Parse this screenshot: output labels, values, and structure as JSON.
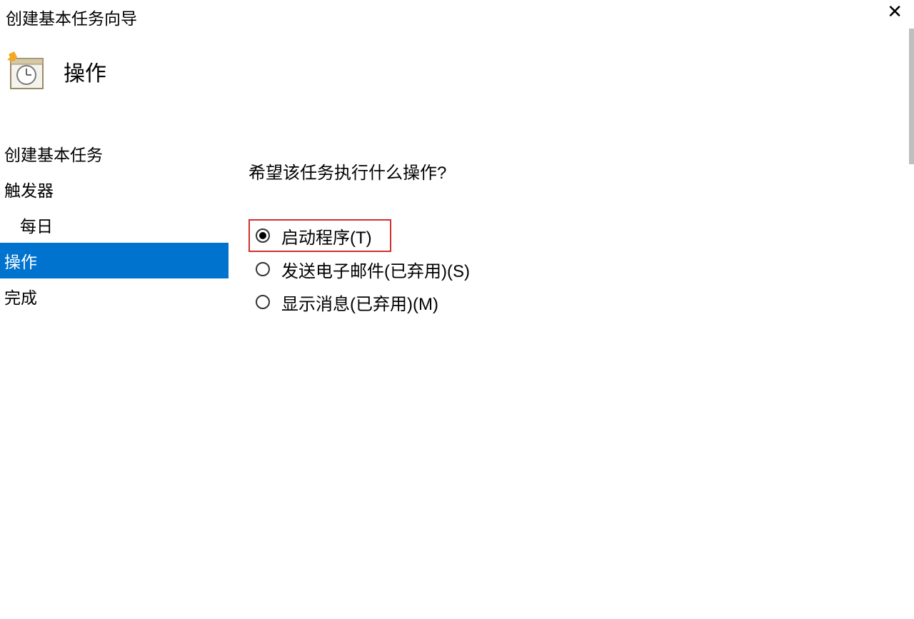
{
  "titlebar": {
    "title": "创建基本任务向导"
  },
  "header": {
    "label": "操作"
  },
  "sidebar": {
    "items": [
      {
        "label": "创建基本任务",
        "sub": false,
        "selected": false
      },
      {
        "label": "触发器",
        "sub": false,
        "selected": false
      },
      {
        "label": "每日",
        "sub": true,
        "selected": false
      },
      {
        "label": "操作",
        "sub": false,
        "selected": true
      },
      {
        "label": "完成",
        "sub": false,
        "selected": false
      }
    ]
  },
  "content": {
    "question": "希望该任务执行什么操作?",
    "options": [
      {
        "label": "启动程序(T)",
        "checked": true,
        "highlighted": true
      },
      {
        "label": "发送电子邮件(已弃用)(S)",
        "checked": false,
        "highlighted": false
      },
      {
        "label": "显示消息(已弃用)(M)",
        "checked": false,
        "highlighted": false
      }
    ]
  }
}
